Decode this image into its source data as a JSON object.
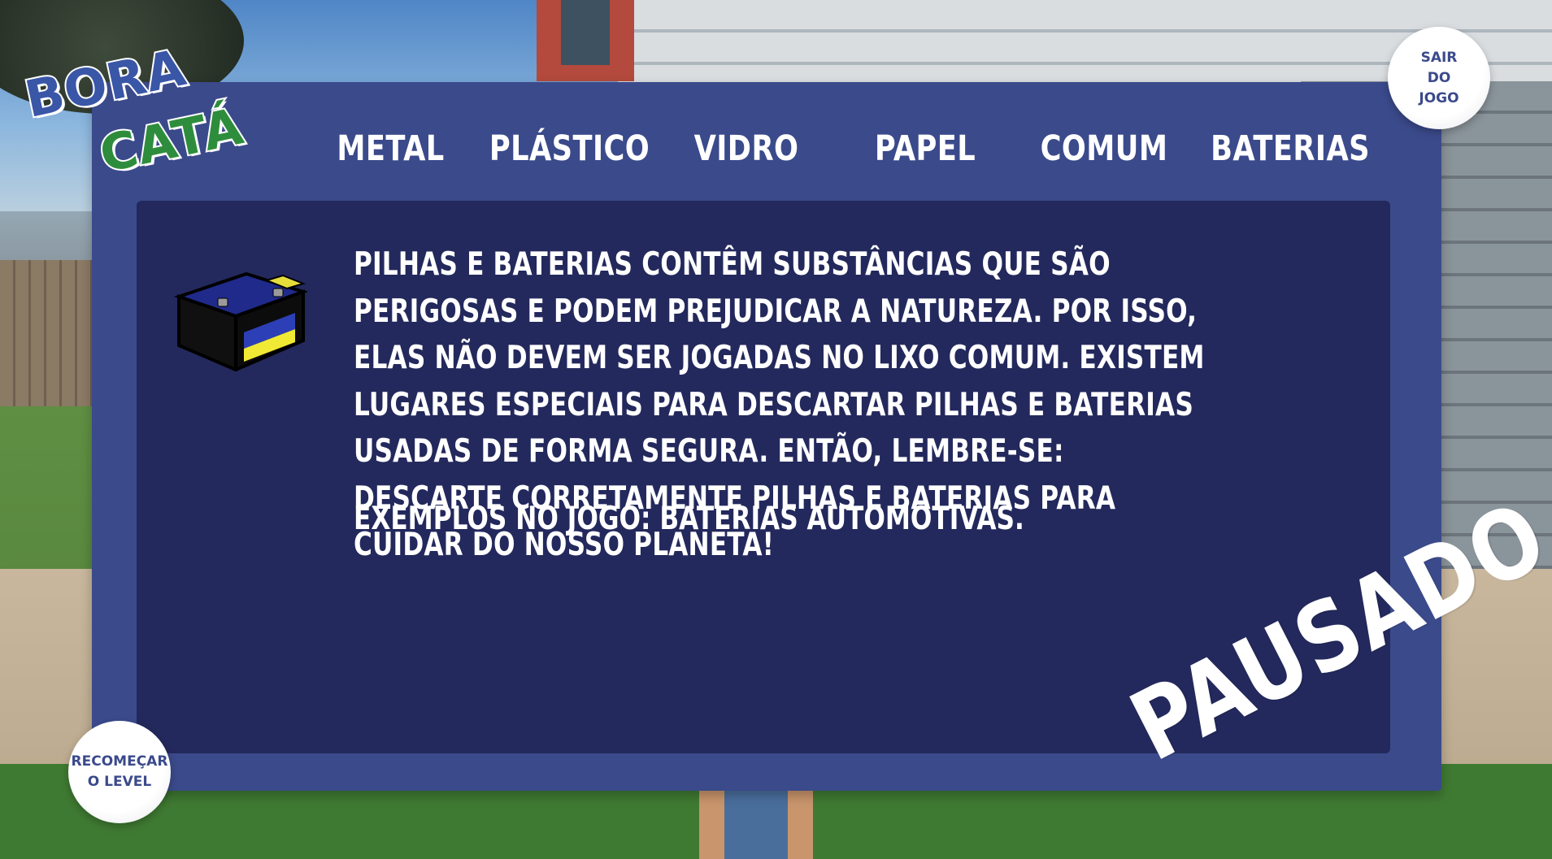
{
  "logo": {
    "line1": "BORA",
    "line2": "CATÁ"
  },
  "tabs": [
    {
      "label": "METAL"
    },
    {
      "label": "PLÁSTICO"
    },
    {
      "label": "VIDRO"
    },
    {
      "label": "PAPEL"
    },
    {
      "label": "COMUM"
    },
    {
      "label": "BATERIAS"
    }
  ],
  "selected_tab": "BATERIAS",
  "content": {
    "icon": "car-battery-icon",
    "description": "PILHAS E BATERIAS CONTÊM SUBSTÂNCIAS QUE SÃO PERIGOSAS E PODEM PREJUDICAR A NATUREZA. POR ISSO, ELAS NÃO DEVEM SER JOGADAS NO LIXO COMUM. EXISTEM LUGARES ESPECIAIS PARA DESCARTAR PILHAS E BATERIAS USADAS DE FORMA SEGURA. ENTÃO, LEMBRE-SE: DESCARTE CORRETAMENTE PILHAS E BATERIAS PARA CUIDAR DO NOSSO PLANETA!",
    "examples": "EXEMPLOS NO JOGO: BATERIAS AUTOMOTIVAS."
  },
  "buttons": {
    "exit": "SAIR\nDO\nJOGO",
    "restart": "RECOMEÇAR\nO LEVEL"
  },
  "status": "PAUSADO",
  "colors": {
    "panel": "#3b4a8b",
    "content_bg": "#23295c",
    "button_text": "#3b4a8b",
    "logo_blue": "#3a56a7",
    "logo_green": "#2e8d3c"
  }
}
